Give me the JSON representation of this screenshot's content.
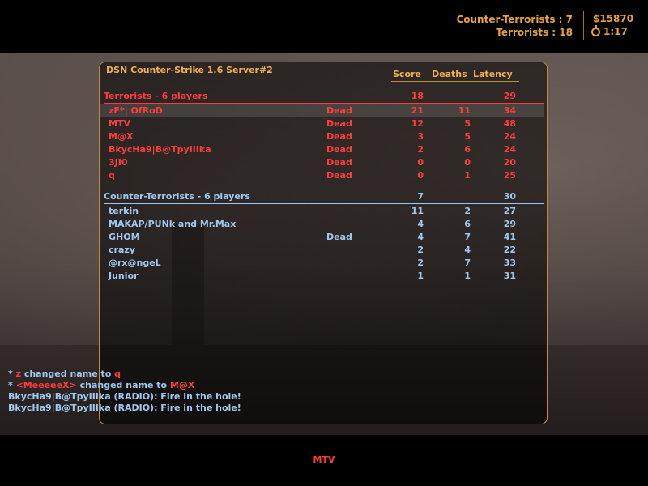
{
  "hud": {
    "ct_label": "Counter-Terrorists :",
    "ct_score": "7",
    "t_label": "Terrorists :",
    "t_score": "18",
    "money": "$15870",
    "timer": "1:17"
  },
  "scoreboard": {
    "server_name": "DSN Counter-Strike 1.6 Server#2",
    "columns": {
      "score": "Score",
      "deaths": "Deaths",
      "latency": "Latency"
    },
    "terrorists": {
      "label": "Terrorists   -   6 players",
      "score": "18",
      "latency": "29",
      "players": [
        {
          "name": "zF*| OfRoD",
          "status": "Dead",
          "score": "21",
          "deaths": "11",
          "latency": "34"
        },
        {
          "name": "MTV",
          "status": "Dead",
          "score": "12",
          "deaths": "5",
          "latency": "48"
        },
        {
          "name": "M@X",
          "status": "Dead",
          "score": "3",
          "deaths": "5",
          "latency": "24"
        },
        {
          "name": "BkycHa9|B@TpyIIIka",
          "status": "Dead",
          "score": "2",
          "deaths": "6",
          "latency": "24"
        },
        {
          "name": "3JI0",
          "status": "Dead",
          "score": "0",
          "deaths": "0",
          "latency": "20"
        },
        {
          "name": "q",
          "status": "Dead",
          "score": "0",
          "deaths": "1",
          "latency": "25"
        }
      ]
    },
    "counter_terrorists": {
      "label": "Counter-Terrorists   -   6 players",
      "score": "7",
      "latency": "30",
      "players": [
        {
          "name": "terkin",
          "status": "",
          "score": "11",
          "deaths": "2",
          "latency": "27"
        },
        {
          "name": "MAKAP/PUNk and Mr.Max",
          "status": "",
          "score": "4",
          "deaths": "6",
          "latency": "29"
        },
        {
          "name": "GHOM",
          "status": "Dead",
          "score": "4",
          "deaths": "7",
          "latency": "41"
        },
        {
          "name": "crazy",
          "status": "",
          "score": "2",
          "deaths": "4",
          "latency": "22"
        },
        {
          "name": "@rx@ngeL",
          "status": "",
          "score": "2",
          "deaths": "7",
          "latency": "33"
        },
        {
          "name": "Junior",
          "status": "",
          "score": "1",
          "deaths": "1",
          "latency": "31"
        }
      ]
    }
  },
  "chat": [
    {
      "prefix": "* ",
      "name": "z",
      "text": " changed name to ",
      "target": "q"
    },
    {
      "prefix": "* ",
      "name": "<MeeeeeX>",
      "text": " changed name to ",
      "target": "M@X"
    },
    {
      "line": "BkycHa9|B@TpyIIIka (RADIO): Fire in the hole!"
    },
    {
      "line": "BkycHa9|B@TpyIIIka (RADIO): Fire in the hole!"
    }
  ],
  "spectating": "MTV",
  "colors": {
    "terrorist": "#ff3c3c",
    "counter_terrorist": "#9ec8f0",
    "hud": "#e8a23a"
  }
}
